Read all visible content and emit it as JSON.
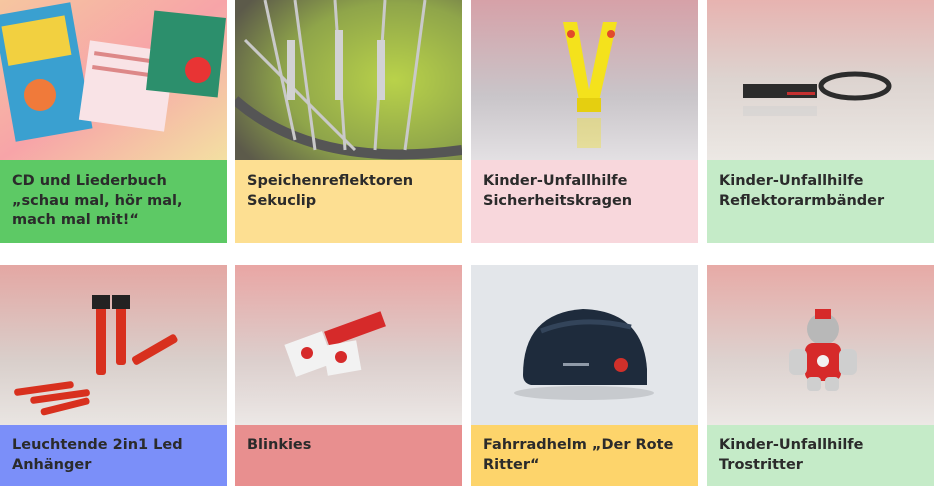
{
  "products": [
    {
      "title": "CD und Liederbuch „schau mal, hör mal, mach mal mit!“",
      "label_color": "#5dc965",
      "image": "cd-booklet-image"
    },
    {
      "title": "Speichenreflektoren Sekuclip",
      "label_color": "#fddf92",
      "image": "spoke-reflectors-image"
    },
    {
      "title": "Kinder-Unfallhilfe Sicherheitskragen",
      "label_color": "#f8d7dc",
      "image": "safety-collar-image"
    },
    {
      "title": "Kinder-Unfallhilfe Reflektorarmbänder",
      "label_color": "#c5ebc8",
      "image": "reflector-bands-image"
    },
    {
      "title": "Leuchtende 2in1 Led Anhänger",
      "label_color": "#7b8ff9",
      "image": "led-pendants-image"
    },
    {
      "title": "Blinkies",
      "label_color": "#e88f8f",
      "image": "blinkies-image"
    },
    {
      "title": "Fahrradhelm „Der Rote Ritter“",
      "label_color": "#fdd46b",
      "image": "bike-helmet-image"
    },
    {
      "title": "Kinder-Unfallhilfe Trostritter",
      "label_color": "#c5ebc8",
      "image": "knight-plush-image"
    }
  ]
}
